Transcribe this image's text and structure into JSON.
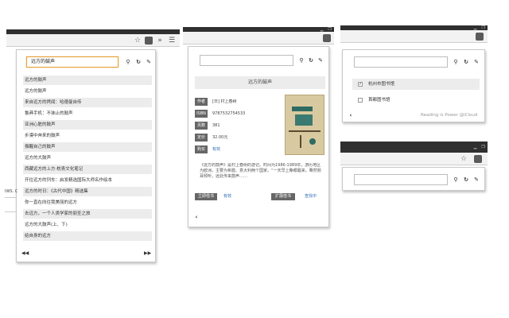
{
  "panel1": {
    "search_value": "远方的鼓声",
    "suggestions": [
      "远方的鼓声",
      "远方的鼓声",
      "来自远方的拷闻：哈德曼自传",
      "鲁莽手机：不抹止的鼓声",
      "亚洲心脏的鼓声",
      "步漠中奔来的鼓声",
      "振醒自己的鼓声",
      "远方的大鼓声",
      "西藏远方的上方·枕青文化笔记",
      "开往远方的列车：启发精选国际大师名作绘本",
      "远方的时日：《古代中国》精选集",
      "你一直在向往我美丽的远方",
      "去远方，一个人类学家的丽圣之旅",
      "远方的大鼓声(上、下)",
      "给自身的远方"
    ],
    "prev_icon": "rewind-icon",
    "next_icon": "fast-forward-icon"
  },
  "panel2": {
    "book_title": "远方的鼓声",
    "fields": [
      {
        "label": "作者",
        "value": "[日] 村上春树"
      },
      {
        "label": "ISBN",
        "value": "9787532754533"
      },
      {
        "label": "页数",
        "value": "381"
      },
      {
        "label": "定价",
        "value": "32.00元"
      },
      {
        "label": "购买",
        "value": "有效"
      }
    ],
    "description": "《远方的鼓声》是村上春树的游记。时间为1986-1989年，游历地区为欧洲，主要为希腊、意大利两个国家。“一天早上睁眼醒来，蓦然侧耳倾听，远处传来鼓声……",
    "lib_button": "立即借书",
    "lib_status": "有效",
    "expand_button": "扩展借书",
    "expand_status": "查找中"
  },
  "panel3": {
    "libraries": [
      {
        "name": "杭州市图书馆",
        "checked": true
      },
      {
        "name": "首都图书馆",
        "checked": false
      }
    ],
    "footer": "Reading is Power @iCloud"
  },
  "background": {
    "left_text_1": "IWS. C",
    "left_text_2": "IWS. C",
    "left_text_3": "IWS. C"
  },
  "icons": {
    "search": "search-icon",
    "refresh": "refresh-icon",
    "settings": "wrench-icon",
    "star": "star-icon",
    "extension": "extension-icon",
    "back": "back-arrow-icon"
  }
}
